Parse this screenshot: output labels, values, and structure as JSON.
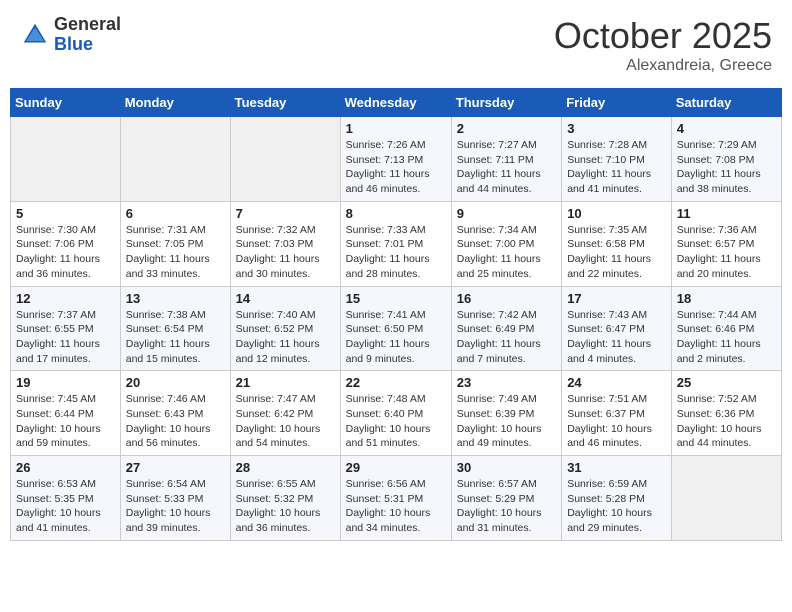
{
  "header": {
    "logo_general": "General",
    "logo_blue": "Blue",
    "month_title": "October 2025",
    "location": "Alexandreia, Greece"
  },
  "days_of_week": [
    "Sunday",
    "Monday",
    "Tuesday",
    "Wednesday",
    "Thursday",
    "Friday",
    "Saturday"
  ],
  "weeks": [
    [
      {
        "day": "",
        "sunrise": "",
        "sunset": "",
        "daylight": ""
      },
      {
        "day": "",
        "sunrise": "",
        "sunset": "",
        "daylight": ""
      },
      {
        "day": "",
        "sunrise": "",
        "sunset": "",
        "daylight": ""
      },
      {
        "day": "1",
        "sunrise": "Sunrise: 7:26 AM",
        "sunset": "Sunset: 7:13 PM",
        "daylight": "Daylight: 11 hours and 46 minutes."
      },
      {
        "day": "2",
        "sunrise": "Sunrise: 7:27 AM",
        "sunset": "Sunset: 7:11 PM",
        "daylight": "Daylight: 11 hours and 44 minutes."
      },
      {
        "day": "3",
        "sunrise": "Sunrise: 7:28 AM",
        "sunset": "Sunset: 7:10 PM",
        "daylight": "Daylight: 11 hours and 41 minutes."
      },
      {
        "day": "4",
        "sunrise": "Sunrise: 7:29 AM",
        "sunset": "Sunset: 7:08 PM",
        "daylight": "Daylight: 11 hours and 38 minutes."
      }
    ],
    [
      {
        "day": "5",
        "sunrise": "Sunrise: 7:30 AM",
        "sunset": "Sunset: 7:06 PM",
        "daylight": "Daylight: 11 hours and 36 minutes."
      },
      {
        "day": "6",
        "sunrise": "Sunrise: 7:31 AM",
        "sunset": "Sunset: 7:05 PM",
        "daylight": "Daylight: 11 hours and 33 minutes."
      },
      {
        "day": "7",
        "sunrise": "Sunrise: 7:32 AM",
        "sunset": "Sunset: 7:03 PM",
        "daylight": "Daylight: 11 hours and 30 minutes."
      },
      {
        "day": "8",
        "sunrise": "Sunrise: 7:33 AM",
        "sunset": "Sunset: 7:01 PM",
        "daylight": "Daylight: 11 hours and 28 minutes."
      },
      {
        "day": "9",
        "sunrise": "Sunrise: 7:34 AM",
        "sunset": "Sunset: 7:00 PM",
        "daylight": "Daylight: 11 hours and 25 minutes."
      },
      {
        "day": "10",
        "sunrise": "Sunrise: 7:35 AM",
        "sunset": "Sunset: 6:58 PM",
        "daylight": "Daylight: 11 hours and 22 minutes."
      },
      {
        "day": "11",
        "sunrise": "Sunrise: 7:36 AM",
        "sunset": "Sunset: 6:57 PM",
        "daylight": "Daylight: 11 hours and 20 minutes."
      }
    ],
    [
      {
        "day": "12",
        "sunrise": "Sunrise: 7:37 AM",
        "sunset": "Sunset: 6:55 PM",
        "daylight": "Daylight: 11 hours and 17 minutes."
      },
      {
        "day": "13",
        "sunrise": "Sunrise: 7:38 AM",
        "sunset": "Sunset: 6:54 PM",
        "daylight": "Daylight: 11 hours and 15 minutes."
      },
      {
        "day": "14",
        "sunrise": "Sunrise: 7:40 AM",
        "sunset": "Sunset: 6:52 PM",
        "daylight": "Daylight: 11 hours and 12 minutes."
      },
      {
        "day": "15",
        "sunrise": "Sunrise: 7:41 AM",
        "sunset": "Sunset: 6:50 PM",
        "daylight": "Daylight: 11 hours and 9 minutes."
      },
      {
        "day": "16",
        "sunrise": "Sunrise: 7:42 AM",
        "sunset": "Sunset: 6:49 PM",
        "daylight": "Daylight: 11 hours and 7 minutes."
      },
      {
        "day": "17",
        "sunrise": "Sunrise: 7:43 AM",
        "sunset": "Sunset: 6:47 PM",
        "daylight": "Daylight: 11 hours and 4 minutes."
      },
      {
        "day": "18",
        "sunrise": "Sunrise: 7:44 AM",
        "sunset": "Sunset: 6:46 PM",
        "daylight": "Daylight: 11 hours and 2 minutes."
      }
    ],
    [
      {
        "day": "19",
        "sunrise": "Sunrise: 7:45 AM",
        "sunset": "Sunset: 6:44 PM",
        "daylight": "Daylight: 10 hours and 59 minutes."
      },
      {
        "day": "20",
        "sunrise": "Sunrise: 7:46 AM",
        "sunset": "Sunset: 6:43 PM",
        "daylight": "Daylight: 10 hours and 56 minutes."
      },
      {
        "day": "21",
        "sunrise": "Sunrise: 7:47 AM",
        "sunset": "Sunset: 6:42 PM",
        "daylight": "Daylight: 10 hours and 54 minutes."
      },
      {
        "day": "22",
        "sunrise": "Sunrise: 7:48 AM",
        "sunset": "Sunset: 6:40 PM",
        "daylight": "Daylight: 10 hours and 51 minutes."
      },
      {
        "day": "23",
        "sunrise": "Sunrise: 7:49 AM",
        "sunset": "Sunset: 6:39 PM",
        "daylight": "Daylight: 10 hours and 49 minutes."
      },
      {
        "day": "24",
        "sunrise": "Sunrise: 7:51 AM",
        "sunset": "Sunset: 6:37 PM",
        "daylight": "Daylight: 10 hours and 46 minutes."
      },
      {
        "day": "25",
        "sunrise": "Sunrise: 7:52 AM",
        "sunset": "Sunset: 6:36 PM",
        "daylight": "Daylight: 10 hours and 44 minutes."
      }
    ],
    [
      {
        "day": "26",
        "sunrise": "Sunrise: 6:53 AM",
        "sunset": "Sunset: 5:35 PM",
        "daylight": "Daylight: 10 hours and 41 minutes."
      },
      {
        "day": "27",
        "sunrise": "Sunrise: 6:54 AM",
        "sunset": "Sunset: 5:33 PM",
        "daylight": "Daylight: 10 hours and 39 minutes."
      },
      {
        "day": "28",
        "sunrise": "Sunrise: 6:55 AM",
        "sunset": "Sunset: 5:32 PM",
        "daylight": "Daylight: 10 hours and 36 minutes."
      },
      {
        "day": "29",
        "sunrise": "Sunrise: 6:56 AM",
        "sunset": "Sunset: 5:31 PM",
        "daylight": "Daylight: 10 hours and 34 minutes."
      },
      {
        "day": "30",
        "sunrise": "Sunrise: 6:57 AM",
        "sunset": "Sunset: 5:29 PM",
        "daylight": "Daylight: 10 hours and 31 minutes."
      },
      {
        "day": "31",
        "sunrise": "Sunrise: 6:59 AM",
        "sunset": "Sunset: 5:28 PM",
        "daylight": "Daylight: 10 hours and 29 minutes."
      },
      {
        "day": "",
        "sunrise": "",
        "sunset": "",
        "daylight": ""
      }
    ]
  ]
}
